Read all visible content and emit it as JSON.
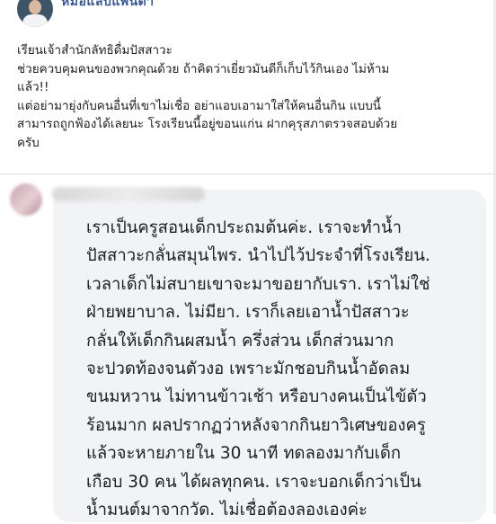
{
  "post": {
    "author": "หมอแล็บแพนด้า",
    "lines": [
      "เรียนเจ้าสำนักลัทธิดื่มปัสสาวะ",
      "ช่วยควบคุมคนของพวกคุณด้วย ถ้าคิดว่าเยี่ยวมันดีก็เก็บไว้กินเอง ไม่ห้าม",
      "แล้ว!!",
      "แต่อย่ามายุ่งกับคนอื่นที่เขาไม่เชื่อ อย่าแอบเอามาใส่ให้คนอื่นกิน แบบนี้",
      "สามารถถูกฟ้องได้เลยนะ โรงเรียนนี้อยู่ขอนแก่น ฝากคุรุสภาตรวจสอบด้วย",
      "ครับ"
    ]
  },
  "comment": {
    "lines": [
      "เราเป็นครูสอนเด็กประถมต้นค่ะ. เราจะทำน้ำ",
      "ปัสสาวะกลั่นสมุนไพร. นำไปไว้ประจำที่โรงเรียน.",
      "เวลาเด็กไม่สบายเขาจะมาขอยากับเรา. เราไม่ใช่",
      "ฝ่ายพยาบาล. ไม่มียา. เราก็เลยเอาน้ำปัสสาวะ",
      "กลั่นให้เด็กกินผสมน้ำ ครึ่งส่วน เด็กส่วนมาก",
      "จะปวดท้องจนตัวงอ เพราะมักชอบกินน้ำอัดลม",
      "ขนมหวาน ไม่ทานข้าวเช้า หรือบางคนเป็นไข้ตัว",
      "ร้อนมาก ผลปรากฏว่าหลังจากกินยาวิเศษของครู",
      "แล้วจะหายภายใน 30 นาที ทดลองมากับเด็ก",
      "เกือบ 30 คน ได้ผลทุกคน. เราจะบอกเด็กว่าเป็น",
      "น้ำมนต์มาจากวัด. ไม่เชื่อต้องลองเองค่ะ"
    ]
  }
}
